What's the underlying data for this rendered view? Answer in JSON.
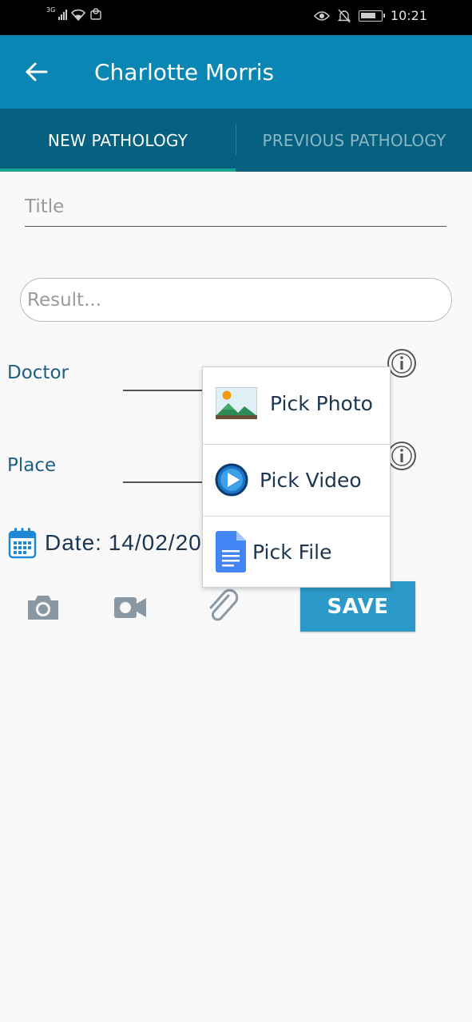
{
  "status_bar": {
    "network": "3G",
    "time": "10:21"
  },
  "app_bar": {
    "title": "Charlotte Morris",
    "back_icon": "arrow-left-icon"
  },
  "tabs": [
    {
      "label": "NEW PATHOLOGY",
      "selected": true
    },
    {
      "label": "PREVIOUS PATHOLOGY",
      "selected": false
    }
  ],
  "form": {
    "title_placeholder": "Title",
    "result_placeholder": "Result...",
    "doctor_label": "Doctor",
    "place_label": "Place",
    "date_label": "Date:",
    "date_value": "14/02/20"
  },
  "actions": {
    "save_label": "SAVE",
    "icons": [
      "camera-icon",
      "video-camera-icon",
      "paperclip-icon"
    ]
  },
  "popup_menu": {
    "items": [
      {
        "label": "Pick Photo",
        "icon": "image-icon"
      },
      {
        "label": "Pick Video",
        "icon": "play-circle-icon"
      },
      {
        "label": "Pick File",
        "icon": "document-icon"
      }
    ]
  },
  "colors": {
    "app_bar": "#0a86b5",
    "tab_bar": "#06607f",
    "tab_indicator": "#1aa68e",
    "save_button": "#2b9ac8",
    "label_text": "#1e5f84"
  }
}
